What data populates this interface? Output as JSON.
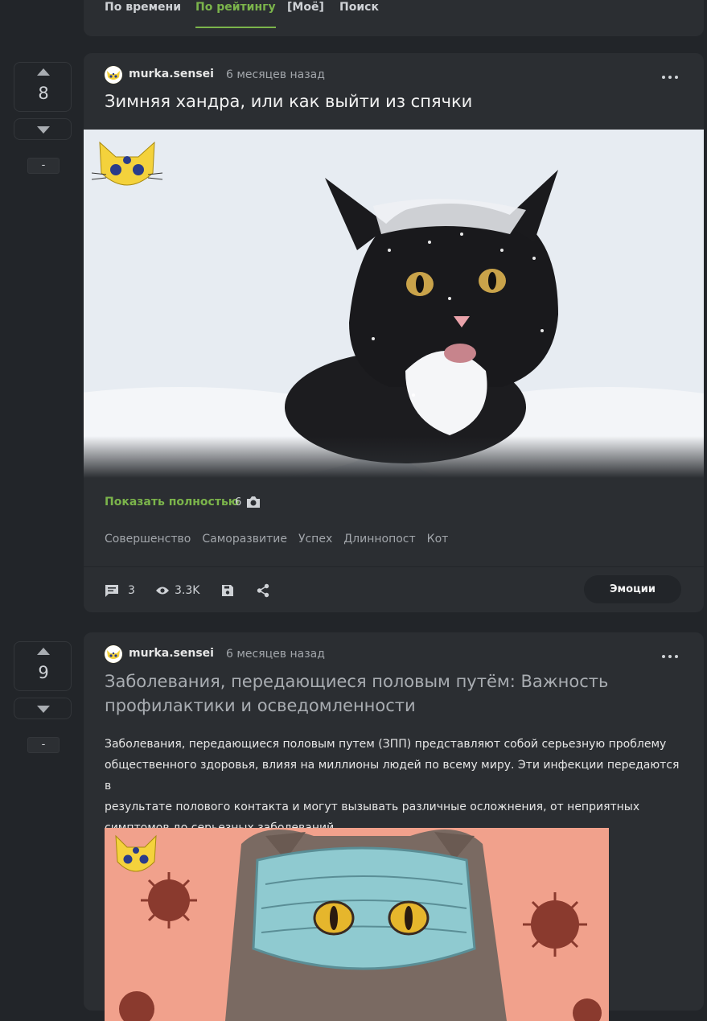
{
  "tabs": [
    {
      "label": "По времени",
      "active": false
    },
    {
      "label": "По рейтингу",
      "active": true
    },
    {
      "label": "[Моё]",
      "active": false
    },
    {
      "label": "Поиск",
      "active": false
    }
  ],
  "posts": [
    {
      "score": "8",
      "minus": "-",
      "author": "murka.sensei",
      "time": "6 месяцев назад",
      "title": "Зимняя хандра, или как выйти из спячки",
      "show_full": "Показать полностью",
      "photo_count": "6",
      "tags": [
        "Совершенство",
        "Саморазвитие",
        "Успех",
        "Длиннопост",
        "Кот"
      ],
      "comments": "3",
      "views": "3.3K",
      "emotions_label": "Эмоции"
    },
    {
      "score": "9",
      "minus": "-",
      "author": "murka.sensei",
      "time": "6 месяцев назад",
      "title_line1": "Заболевания, передающиеся половым путём: Важность",
      "title_line2": "профилактики и осведомленности",
      "body_lines": [
        "Заболевания, передающиеся половым путем (ЗПП) представляют собой серьезную проблему",
        "общественного здоровья, влияя на миллионы людей по всему миру. Эти инфекции передаются в",
        "результате полового контакта и могут вызывать различные осложнения, от неприятных",
        "симптомов до серьезных заболеваний."
      ]
    }
  ],
  "colors": {
    "accent": "#7bb44b",
    "background": "#222529",
    "card": "#2b2e32"
  }
}
